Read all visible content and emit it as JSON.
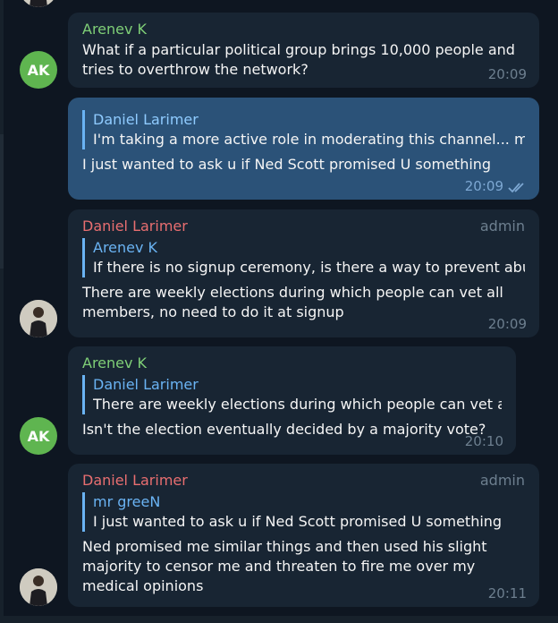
{
  "messages": [
    {
      "sender": "Arenev K",
      "avatar": "AK",
      "text": "What if a particular political group brings 10,000 people and tries to overthrow the network?",
      "time": "20:09"
    },
    {
      "reply_name": "Daniel Larimer",
      "reply_text": "I'm taking a more active role in moderating this channel... my ...",
      "text": "I just wanted to ask u if Ned Scott promised U something",
      "time": "20:09",
      "status_icon": "double-check-icon"
    },
    {
      "sender": "Daniel Larimer",
      "role": "admin",
      "reply_name": "Arenev K",
      "reply_text": "If there is no signup ceremony, is there a way to prevent abus...",
      "text": "There are weekly elections during which people can vet all members, no need to do it at signup",
      "time": "20:09"
    },
    {
      "sender": "Arenev K",
      "avatar": "AK",
      "reply_name": "Daniel Larimer",
      "reply_text": "There are weekly elections during which people can vet all ...",
      "text": "Isn't the election eventually decided by a majority vote?",
      "time": "20:10"
    },
    {
      "sender": "Daniel Larimer",
      "role": "admin",
      "reply_name": "mr greeN",
      "reply_text": "I just wanted to ask u if Ned Scott promised U something",
      "text": "Ned promised me similar things and then used his slight majority to censor me and threaten to fire me over my medical opinions",
      "time": "20:11"
    }
  ],
  "colors": {
    "background": "#0e1621",
    "incoming_bubble": "#182533",
    "outgoing_bubble": "#2b5278",
    "sender_green": "#7fcf77",
    "sender_red": "#e86e70",
    "reply_accent": "#6ab3f3",
    "avatar_green": "#5fb550"
  }
}
